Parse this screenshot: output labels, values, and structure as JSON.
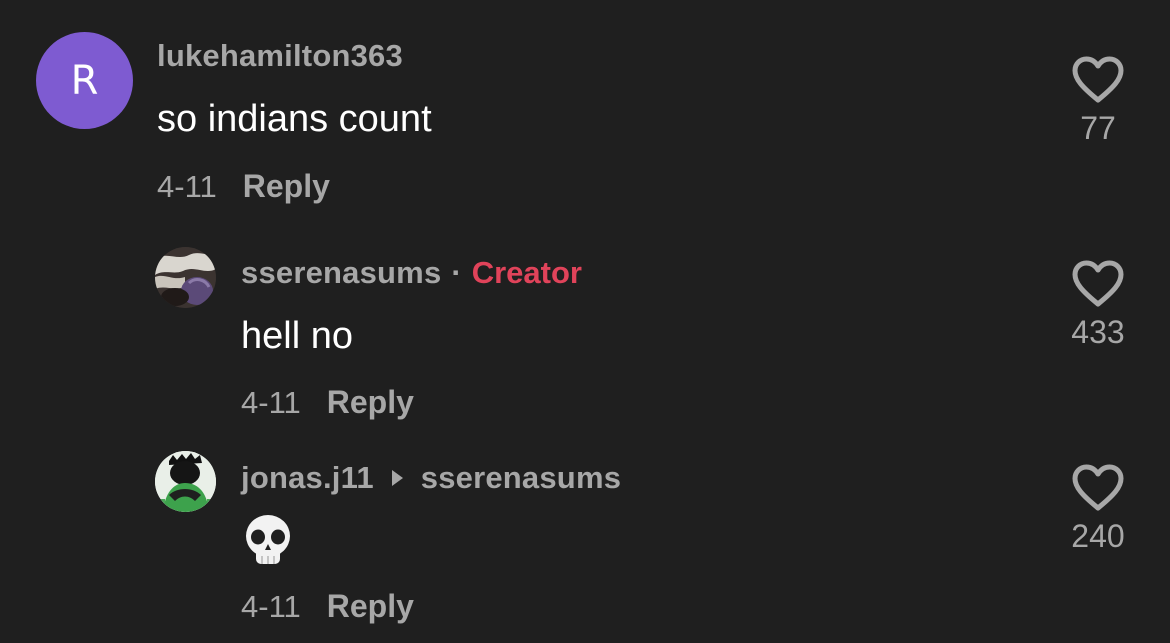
{
  "comments": [
    {
      "avatar_letter": "R",
      "username": "lukehamilton363",
      "text": "so indians count",
      "date": "4-11",
      "reply_label": "Reply",
      "likes": "77"
    },
    {
      "username": "sserenasums",
      "separator": "·",
      "badge": "Creator",
      "text": "hell no",
      "date": "4-11",
      "reply_label": "Reply",
      "likes": "433"
    },
    {
      "username": "jonas.j11",
      "reply_to": "sserenasums",
      "emoji_icon": "skull-icon",
      "date": "4-11",
      "reply_label": "Reply",
      "likes": "240"
    }
  ],
  "colors": {
    "background": "#1f1f1f",
    "avatar_purple": "#7e5bd1",
    "creator_red": "#e0435a",
    "secondary_text": "#a7a7a7",
    "primary_text": "#ffffff"
  }
}
